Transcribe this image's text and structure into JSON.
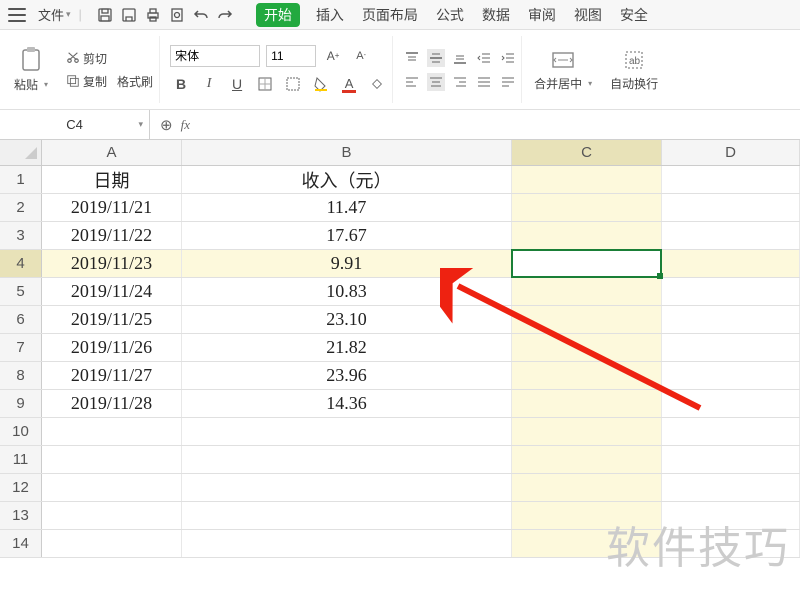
{
  "menu": {
    "file": "文件",
    "tabs": [
      "开始",
      "插入",
      "页面布局",
      "公式",
      "数据",
      "审阅",
      "视图",
      "安全"
    ],
    "activeTabIndex": 0
  },
  "clipboard": {
    "paste": "粘贴",
    "cut": "剪切",
    "copy": "复制",
    "formatPainter": "格式刷"
  },
  "font": {
    "name": "宋体",
    "size": "11"
  },
  "alignment": {
    "mergeCenter": "合并居中",
    "wrapText": "自动换行"
  },
  "nameBox": "C4",
  "chart_data": {
    "type": "table",
    "headers": [
      "日期",
      "收入（元）"
    ],
    "rows": [
      [
        "2019/11/21",
        "11.47"
      ],
      [
        "2019/11/22",
        "17.67"
      ],
      [
        "2019/11/23",
        "9.91"
      ],
      [
        "2019/11/24",
        "10.83"
      ],
      [
        "2019/11/25",
        "23.10"
      ],
      [
        "2019/11/26",
        "21.82"
      ],
      [
        "2019/11/27",
        "23.96"
      ],
      [
        "2019/11/28",
        "14.36"
      ]
    ]
  },
  "columns": [
    "A",
    "B",
    "C",
    "D"
  ],
  "visibleRowCount": 14,
  "selectedCell": {
    "col": "C",
    "row": 4
  },
  "watermark": "软件技巧"
}
